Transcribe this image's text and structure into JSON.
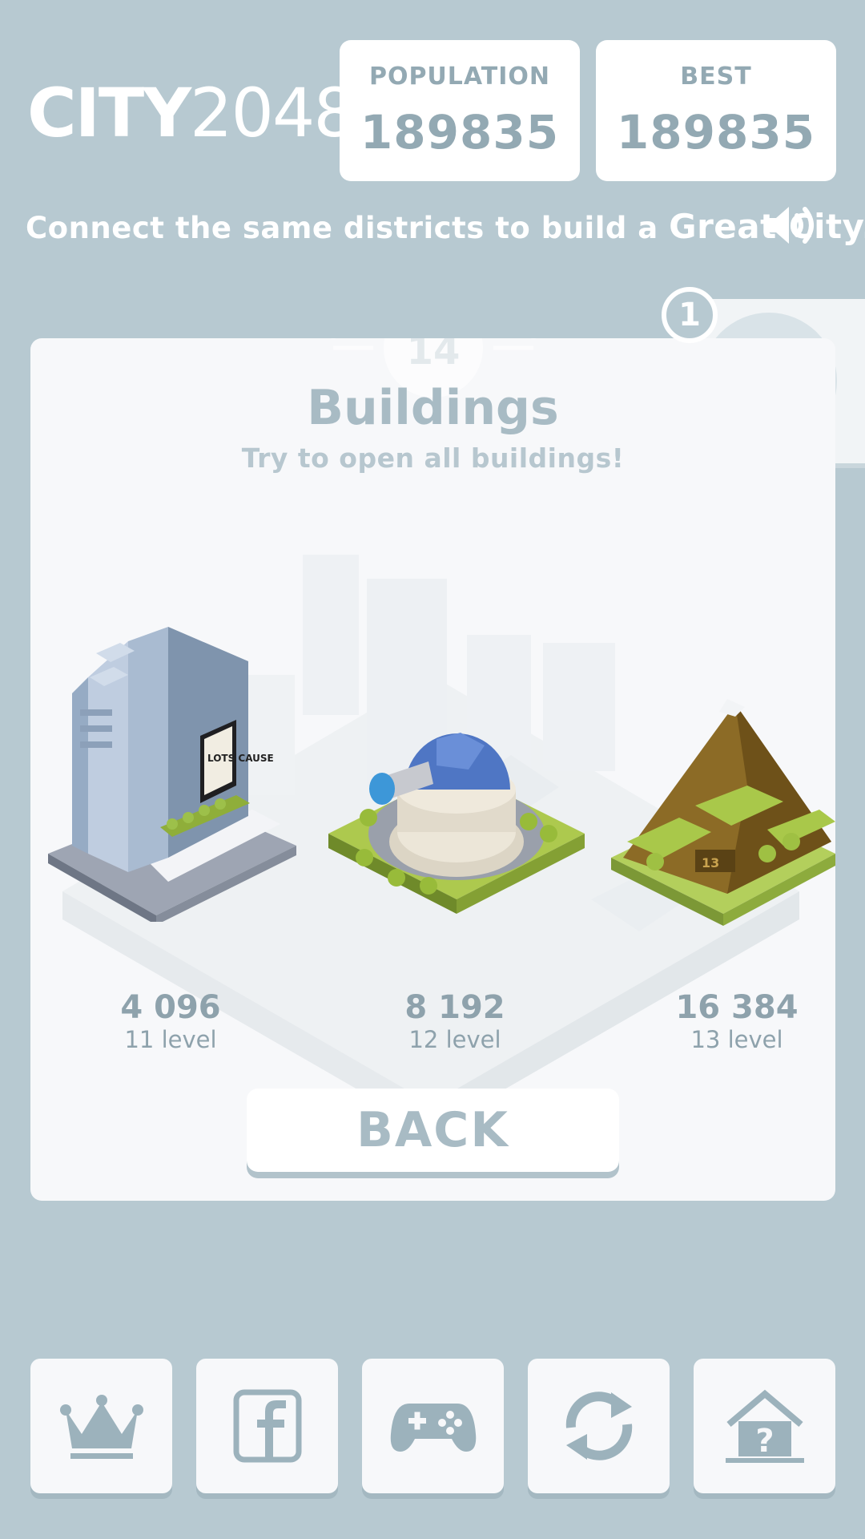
{
  "header": {
    "logo_bold": "CITY",
    "logo_light": "2048",
    "population": {
      "label": "POPULATION",
      "value": "189835"
    },
    "best": {
      "label": "BEST",
      "value": "189835"
    }
  },
  "tagline": {
    "text": "Connect the same districts to build a ",
    "emphasis": "Great City."
  },
  "side_tab": {
    "badge_count": "1"
  },
  "dialog": {
    "emblem_number": "14",
    "title": "Buildings",
    "subtitle": "Try to open all buildings!",
    "buildings": [
      {
        "name": "skyscraper",
        "score": "4 096",
        "level": "11 level"
      },
      {
        "name": "observatory",
        "score": "8 192",
        "level": "12 level"
      },
      {
        "name": "mountain",
        "score": "16 384",
        "level": "13 level"
      }
    ],
    "sign_text": "LOTS CAUSE",
    "mountain_mark": "13",
    "back_label": "BACK"
  },
  "bottom_nav": [
    {
      "icon": "crown-icon"
    },
    {
      "icon": "facebook-icon"
    },
    {
      "icon": "gamepad-icon"
    },
    {
      "icon": "refresh-icon"
    },
    {
      "icon": "home-help-icon"
    }
  ],
  "colors": {
    "background": "#b7c9d1",
    "panel": "#f7f8fa",
    "text_muted": "#93a9b3"
  }
}
